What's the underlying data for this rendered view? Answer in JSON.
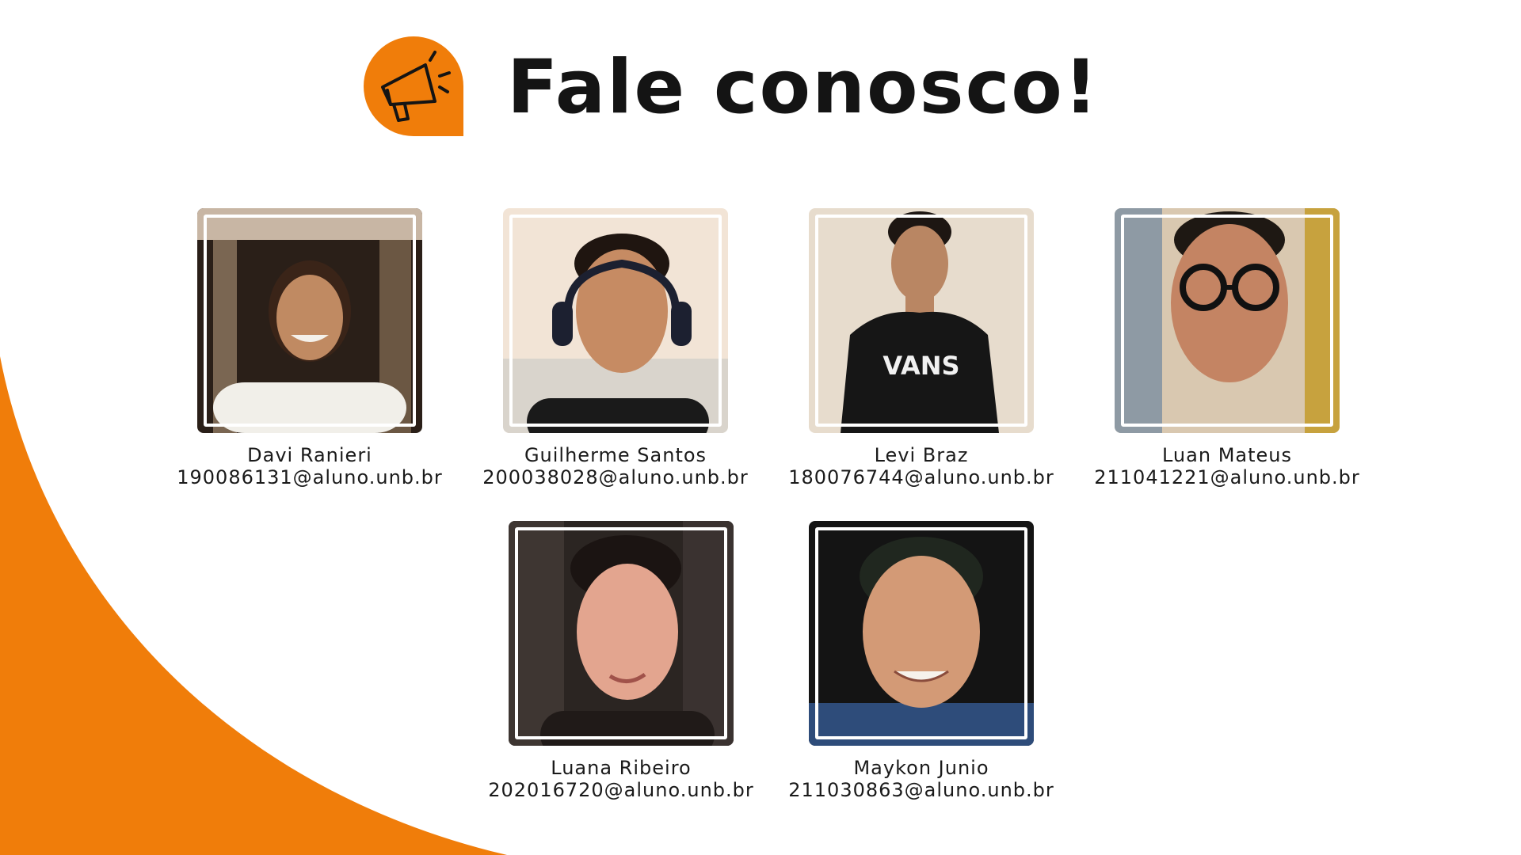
{
  "title": "Fale conosco!",
  "colors": {
    "accent": "#f07d0a",
    "text": "#141414",
    "background": "#ffffff"
  },
  "header_icon": "megaphone-icon",
  "members": [
    {
      "name": "Davi Ranieri",
      "email": "190086131@aluno.unb.br"
    },
    {
      "name": "Guilherme Santos",
      "email": "200038028@aluno.unb.br"
    },
    {
      "name": "Levi Braz",
      "email": "180076744@aluno.unb.br"
    },
    {
      "name": "Luan Mateus",
      "email": "211041221@aluno.unb.br"
    },
    {
      "name": "Luana Ribeiro",
      "email": "202016720@aluno.unb.br"
    },
    {
      "name": "Maykon Junio",
      "email": "211030863@aluno.unb.br"
    }
  ]
}
